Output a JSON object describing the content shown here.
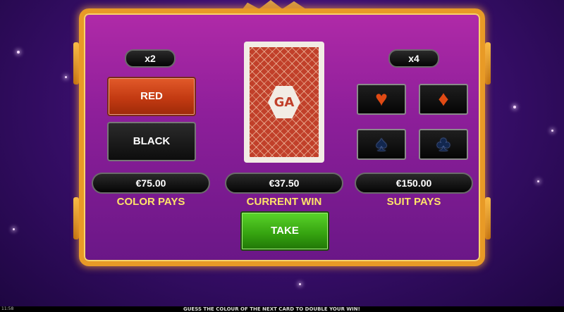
{
  "game": {
    "left": {
      "multiplier": "x2",
      "red_label": "RED",
      "black_label": "BLACK",
      "amount": "€75.00",
      "caption": "COLOR PAYS"
    },
    "center": {
      "card_logo": "GA",
      "amount": "€37.50",
      "caption": "CURRENT WIN",
      "take_label": "TAKE"
    },
    "right": {
      "multiplier": "x4",
      "suits": [
        {
          "name": "hearts",
          "glyph": "♥"
        },
        {
          "name": "diamonds",
          "glyph": "♦"
        },
        {
          "name": "spades",
          "glyph": "♠"
        },
        {
          "name": "clubs",
          "glyph": "♣"
        }
      ],
      "amount": "€150.00",
      "caption": "SUIT PAYS"
    }
  },
  "status_bar": {
    "time": "11:58",
    "message": "GUESS THE COLOUR OF THE NEXT CARD TO DOUBLE YOUR WIN!"
  },
  "colors": {
    "frame_gold": "#e89a26",
    "panel_magenta": "#9e22a0",
    "red_button": "#c33a12",
    "take_green": "#34a10f",
    "label_yellow": "#ffe36a"
  }
}
